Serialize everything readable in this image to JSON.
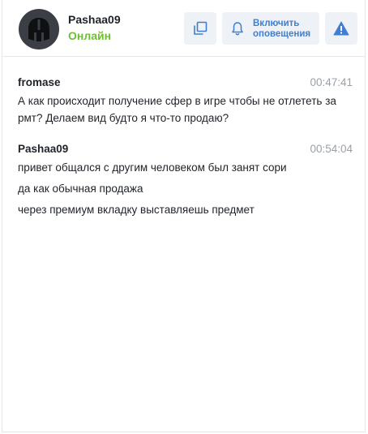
{
  "header": {
    "user": {
      "name": "Pashaa09",
      "status": "Онлайн",
      "status_color": "#6dbf32"
    },
    "buttons": {
      "copy_icon": "copy-icon",
      "notify_label_1": "Включить",
      "notify_label_2": "оповещения",
      "notify_icon": "bell-icon",
      "report_icon": "warning-icon"
    },
    "accent_color": "#3f7ed1"
  },
  "messages": [
    {
      "author": "fromase",
      "time": "00:47:41",
      "lines": [
        "А как происходит получение сфер в игре чтобы не отлететь за рмт? Делаем вид будто я что-то продаю?"
      ]
    },
    {
      "author": "Pashaa09",
      "time": "00:54:04",
      "lines": [
        "привет общался с другим человеком был занят сори",
        "да как обычная продажа",
        "через премиум вкладку выставляешь предмет"
      ]
    }
  ]
}
